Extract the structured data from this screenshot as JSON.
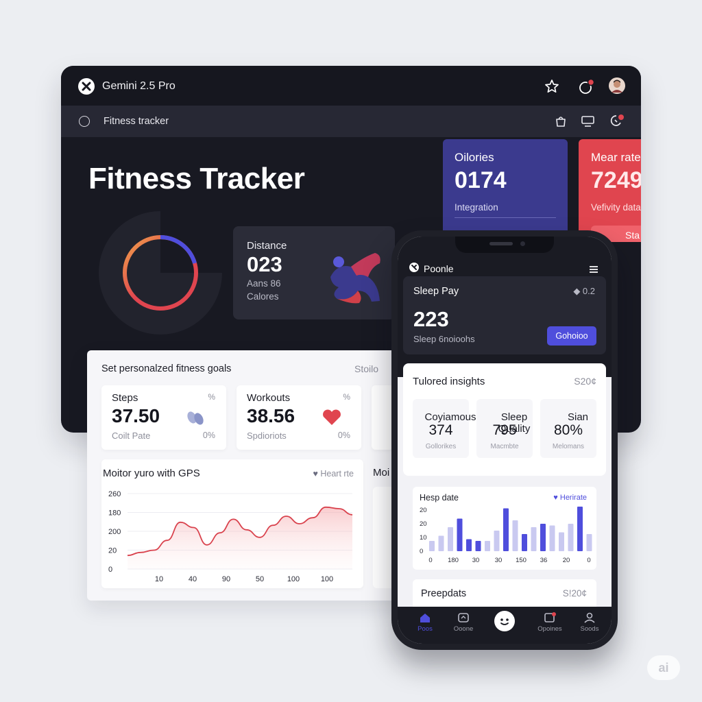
{
  "window": {
    "app_title": "Gemini 2.5 Pro",
    "tab_title": "Fitness tracker",
    "icons": [
      "star-icon",
      "notification-icon",
      "avatar",
      "bag-icon",
      "monitor-icon",
      "alert-icon"
    ]
  },
  "hero": {
    "heading": "Fitness Tracker"
  },
  "distance_card": {
    "label": "Distance",
    "value": "023",
    "line1": "Aans 86",
    "line2": "Calores"
  },
  "calories_card": {
    "title": "Oilories",
    "value": "0174",
    "subtitle": "Integration"
  },
  "heart_card": {
    "title": "Mear rate",
    "value": "7249",
    "subtitle": "Vefivity data",
    "button": "Sta"
  },
  "panel": {
    "title": "Set personalzed fitness goals",
    "right": "Stoilo",
    "cards": [
      {
        "title": "Steps",
        "value": "37.50",
        "sub": "Coilt Pate",
        "pct_top": "%",
        "pct_bottom": "0%"
      },
      {
        "title": "Workouts",
        "value": "38.56",
        "sub": "Spdioriots",
        "pct_top": "%",
        "pct_bottom": "0%"
      }
    ],
    "chart": {
      "title": "Moitor yuro with GPS",
      "legend": "Heart rte",
      "second_title": "Moi"
    }
  },
  "chart_data": {
    "type": "area",
    "title": "Moitor yuro with GPS",
    "legend": "Heart rte",
    "y_ticks": [
      "0",
      "20",
      "200",
      "180",
      "260"
    ],
    "x_ticks": [
      "10",
      "40",
      "90",
      "50",
      "100",
      "100"
    ],
    "series": [
      {
        "name": "Heart rte",
        "values": [
          0.18,
          0.22,
          0.25,
          0.38,
          0.62,
          0.55,
          0.32,
          0.48,
          0.66,
          0.52,
          0.42,
          0.58,
          0.7,
          0.6,
          0.68,
          0.82,
          0.8,
          0.72
        ]
      }
    ]
  },
  "phone": {
    "app_name": "Poonle",
    "sleep_card": {
      "title": "Sleep Pay",
      "right": "◆ 0.2",
      "value": "223",
      "sub": "Sleep 6noioohs",
      "button": "Gohoioo"
    },
    "insights": {
      "title": "Tulored insights",
      "right": "S20¢",
      "cards": [
        {
          "title": "Coyiamous",
          "value": "374",
          "sub": "Gollorikes"
        },
        {
          "title": "Sleep Quality",
          "value": "795",
          "sub": "Macmbte"
        },
        {
          "title": "Sian",
          "value": "80%",
          "sub": "Melomans"
        }
      ]
    },
    "bar_chart": {
      "title": "Hesp date",
      "legend": "Herirate",
      "y_ticks": [
        "0",
        "10",
        "20",
        "20"
      ],
      "x_ticks": [
        "0",
        "180",
        "30",
        "30",
        "150",
        "36",
        "20",
        "0"
      ],
      "values": [
        0.3,
        0.45,
        0.7,
        0.95,
        0.35,
        0.3,
        0.3,
        0.6,
        1.25,
        0.9,
        0.5,
        0.7,
        0.8,
        0.75,
        0.55,
        0.8,
        1.3,
        0.5
      ],
      "accent_index": [
        3,
        4,
        5,
        8,
        10,
        12,
        16
      ]
    },
    "prep_card": {
      "title": "Preepdats",
      "right": "S!20¢"
    },
    "nav": [
      {
        "label": "Poos",
        "icon": "home-icon"
      },
      {
        "label": "Ooone",
        "icon": "chat-icon"
      },
      {
        "label": "",
        "icon": "face-icon"
      },
      {
        "label": "Opoines",
        "icon": "inbox-icon"
      },
      {
        "label": "Soods",
        "icon": "profile-icon"
      }
    ]
  },
  "watermark": "ai",
  "colors": {
    "accent_blue": "#4f4edc",
    "accent_red": "#e0454f",
    "dark_bg": "#181922"
  }
}
